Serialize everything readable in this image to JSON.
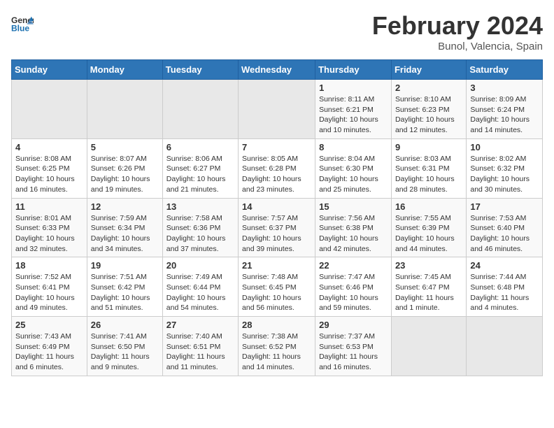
{
  "header": {
    "logo_general": "General",
    "logo_blue": "Blue",
    "title": "February 2024",
    "subtitle": "Bunol, Valencia, Spain"
  },
  "days_of_week": [
    "Sunday",
    "Monday",
    "Tuesday",
    "Wednesday",
    "Thursday",
    "Friday",
    "Saturday"
  ],
  "weeks": [
    [
      {
        "day": "",
        "info": ""
      },
      {
        "day": "",
        "info": ""
      },
      {
        "day": "",
        "info": ""
      },
      {
        "day": "",
        "info": ""
      },
      {
        "day": "1",
        "info": "Sunrise: 8:11 AM\nSunset: 6:21 PM\nDaylight: 10 hours and 10 minutes."
      },
      {
        "day": "2",
        "info": "Sunrise: 8:10 AM\nSunset: 6:23 PM\nDaylight: 10 hours and 12 minutes."
      },
      {
        "day": "3",
        "info": "Sunrise: 8:09 AM\nSunset: 6:24 PM\nDaylight: 10 hours and 14 minutes."
      }
    ],
    [
      {
        "day": "4",
        "info": "Sunrise: 8:08 AM\nSunset: 6:25 PM\nDaylight: 10 hours and 16 minutes."
      },
      {
        "day": "5",
        "info": "Sunrise: 8:07 AM\nSunset: 6:26 PM\nDaylight: 10 hours and 19 minutes."
      },
      {
        "day": "6",
        "info": "Sunrise: 8:06 AM\nSunset: 6:27 PM\nDaylight: 10 hours and 21 minutes."
      },
      {
        "day": "7",
        "info": "Sunrise: 8:05 AM\nSunset: 6:28 PM\nDaylight: 10 hours and 23 minutes."
      },
      {
        "day": "8",
        "info": "Sunrise: 8:04 AM\nSunset: 6:30 PM\nDaylight: 10 hours and 25 minutes."
      },
      {
        "day": "9",
        "info": "Sunrise: 8:03 AM\nSunset: 6:31 PM\nDaylight: 10 hours and 28 minutes."
      },
      {
        "day": "10",
        "info": "Sunrise: 8:02 AM\nSunset: 6:32 PM\nDaylight: 10 hours and 30 minutes."
      }
    ],
    [
      {
        "day": "11",
        "info": "Sunrise: 8:01 AM\nSunset: 6:33 PM\nDaylight: 10 hours and 32 minutes."
      },
      {
        "day": "12",
        "info": "Sunrise: 7:59 AM\nSunset: 6:34 PM\nDaylight: 10 hours and 34 minutes."
      },
      {
        "day": "13",
        "info": "Sunrise: 7:58 AM\nSunset: 6:36 PM\nDaylight: 10 hours and 37 minutes."
      },
      {
        "day": "14",
        "info": "Sunrise: 7:57 AM\nSunset: 6:37 PM\nDaylight: 10 hours and 39 minutes."
      },
      {
        "day": "15",
        "info": "Sunrise: 7:56 AM\nSunset: 6:38 PM\nDaylight: 10 hours and 42 minutes."
      },
      {
        "day": "16",
        "info": "Sunrise: 7:55 AM\nSunset: 6:39 PM\nDaylight: 10 hours and 44 minutes."
      },
      {
        "day": "17",
        "info": "Sunrise: 7:53 AM\nSunset: 6:40 PM\nDaylight: 10 hours and 46 minutes."
      }
    ],
    [
      {
        "day": "18",
        "info": "Sunrise: 7:52 AM\nSunset: 6:41 PM\nDaylight: 10 hours and 49 minutes."
      },
      {
        "day": "19",
        "info": "Sunrise: 7:51 AM\nSunset: 6:42 PM\nDaylight: 10 hours and 51 minutes."
      },
      {
        "day": "20",
        "info": "Sunrise: 7:49 AM\nSunset: 6:44 PM\nDaylight: 10 hours and 54 minutes."
      },
      {
        "day": "21",
        "info": "Sunrise: 7:48 AM\nSunset: 6:45 PM\nDaylight: 10 hours and 56 minutes."
      },
      {
        "day": "22",
        "info": "Sunrise: 7:47 AM\nSunset: 6:46 PM\nDaylight: 10 hours and 59 minutes."
      },
      {
        "day": "23",
        "info": "Sunrise: 7:45 AM\nSunset: 6:47 PM\nDaylight: 11 hours and 1 minute."
      },
      {
        "day": "24",
        "info": "Sunrise: 7:44 AM\nSunset: 6:48 PM\nDaylight: 11 hours and 4 minutes."
      }
    ],
    [
      {
        "day": "25",
        "info": "Sunrise: 7:43 AM\nSunset: 6:49 PM\nDaylight: 11 hours and 6 minutes."
      },
      {
        "day": "26",
        "info": "Sunrise: 7:41 AM\nSunset: 6:50 PM\nDaylight: 11 hours and 9 minutes."
      },
      {
        "day": "27",
        "info": "Sunrise: 7:40 AM\nSunset: 6:51 PM\nDaylight: 11 hours and 11 minutes."
      },
      {
        "day": "28",
        "info": "Sunrise: 7:38 AM\nSunset: 6:52 PM\nDaylight: 11 hours and 14 minutes."
      },
      {
        "day": "29",
        "info": "Sunrise: 7:37 AM\nSunset: 6:53 PM\nDaylight: 11 hours and 16 minutes."
      },
      {
        "day": "",
        "info": ""
      },
      {
        "day": "",
        "info": ""
      }
    ]
  ]
}
